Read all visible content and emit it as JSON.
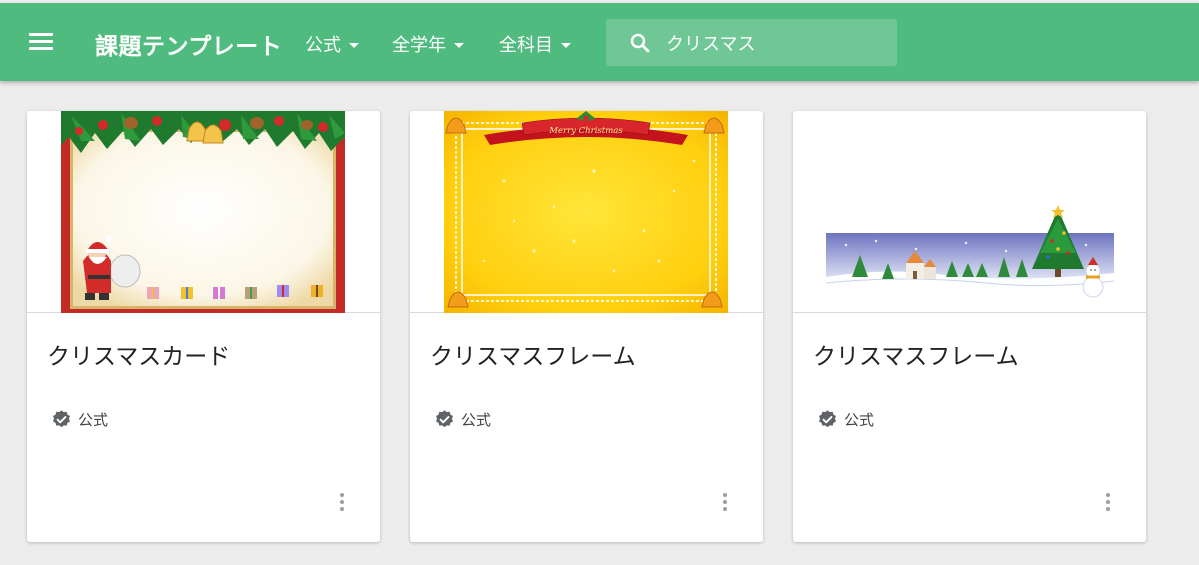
{
  "header": {
    "title": "課題テンプレート",
    "filters": [
      {
        "label": "公式"
      },
      {
        "label": "全学年"
      },
      {
        "label": "全科目"
      }
    ],
    "search": {
      "value": "クリスマス",
      "icon": "search-icon"
    }
  },
  "cards": [
    {
      "title": "クリスマスカード",
      "badge": "公式",
      "thumbnail": "christmas-card-frame"
    },
    {
      "title": "クリスマスフレーム",
      "badge": "公式",
      "thumbnail": "gold-merry-christmas-frame",
      "banner_text": "Merry Christmas"
    },
    {
      "title": "クリスマスフレーム",
      "badge": "公式",
      "thumbnail": "snowy-tree-village-banner"
    }
  ],
  "colors": {
    "header": "#4fbb7e",
    "background": "#ececec"
  }
}
